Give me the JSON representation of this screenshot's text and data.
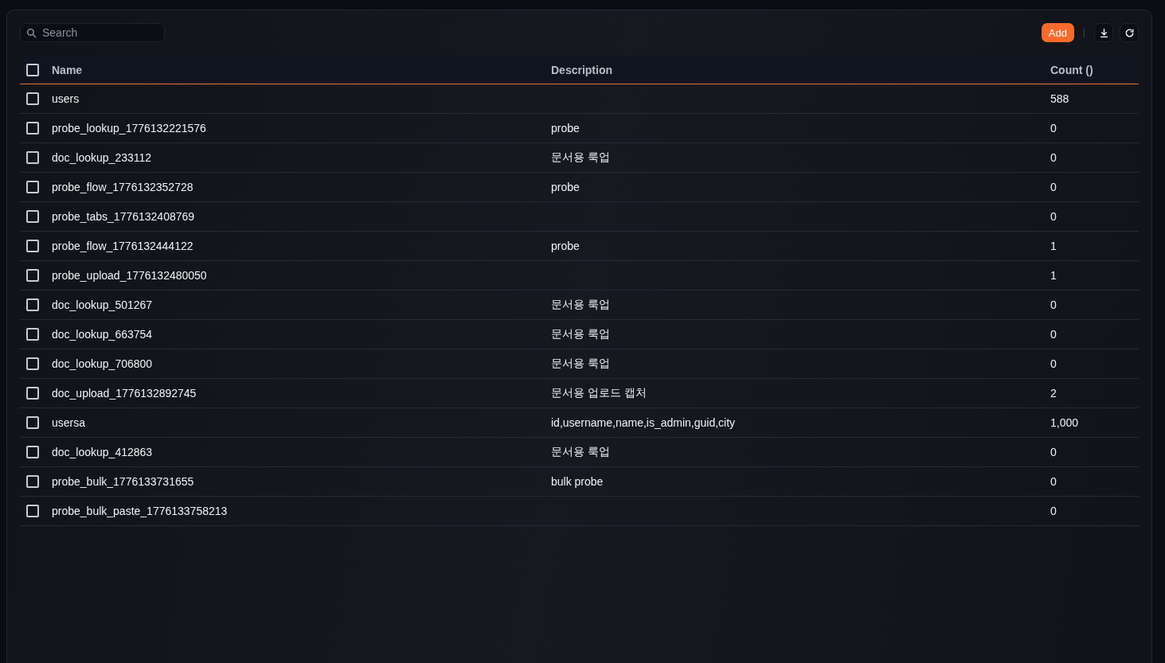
{
  "toolbar": {
    "search": {
      "placeholder": "Search"
    },
    "add_button": "Add"
  },
  "table": {
    "columns": [
      "Name",
      "Description",
      "Count ()"
    ],
    "header_checked": false,
    "rows": [
      {
        "name": "users",
        "count": "588",
        "checked": false
      },
      {
        "name": "probe_lookup_1776132221576",
        "description": "probe",
        "count": "0",
        "checked": false
      },
      {
        "name": "doc_lookup_233112",
        "description": "문서용 룩업",
        "count": "0",
        "checked": false
      },
      {
        "name": "probe_flow_1776132352728",
        "description": "probe",
        "count": "0",
        "checked": false
      },
      {
        "name": "probe_tabs_1776132408769",
        "count": "0",
        "checked": false
      },
      {
        "name": "probe_flow_1776132444122",
        "description": "probe",
        "count": "1",
        "checked": false
      },
      {
        "name": "probe_upload_1776132480050",
        "count": "1",
        "checked": false
      },
      {
        "name": "doc_lookup_501267",
        "description": "문서용 룩업",
        "count": "0",
        "checked": false
      },
      {
        "name": "doc_lookup_663754",
        "description": "문서용 룩업",
        "count": "0",
        "checked": false
      },
      {
        "name": "doc_lookup_706800",
        "description": "문서용 룩업",
        "count": "0",
        "checked": false
      },
      {
        "name": "doc_upload_1776132892745",
        "description": "문서용 업로드 캡처",
        "count": "2",
        "checked": false
      },
      {
        "name": "usersa",
        "description": "id,username,name,is_admin,guid,city",
        "count": "1,000",
        "checked": false
      },
      {
        "name": "doc_lookup_412863",
        "description": "문서용 룩업",
        "count": "0",
        "checked": false
      },
      {
        "name": "probe_bulk_1776133731655",
        "description": "bulk probe",
        "count": "0",
        "checked": false
      },
      {
        "name": "probe_bulk_paste_1776133758213",
        "count": "0",
        "checked": false
      }
    ]
  }
}
